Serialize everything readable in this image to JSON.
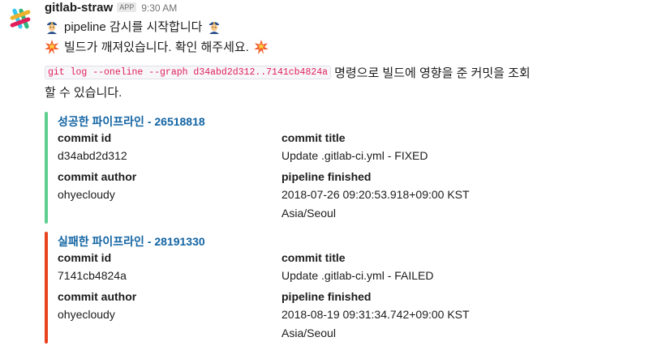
{
  "message": {
    "sender": "gitlab-straw",
    "badge": "APP",
    "time": "9:30 AM",
    "line1": "pipeline 감시를 시작합니다",
    "line2": "빌드가 깨져있습니다. 확인 해주세요.",
    "command": "git log --oneline --graph d34abd2d312..7141cb4824a",
    "line3_rest": "명령으로 빌드에 영향을 준 커밋을 조회",
    "line4": "할 수 있습니다."
  },
  "icons": {
    "avatar": "slack-hash-logo",
    "line1_left": "police-officer-emoji",
    "line1_right": "police-officer-emoji",
    "line2_left": "collision-emoji",
    "line2_right": "collision-emoji"
  },
  "colors": {
    "success": "#5fcf8f",
    "failure": "#e8431e",
    "link": "#1264a3"
  },
  "attachments": [
    {
      "title": "성공한 파이프라인 - 26518818",
      "status": "success",
      "fields": {
        "commit_id_title": "commit id",
        "commit_id_value": "d34abd2d312",
        "commit_title_title": "commit title",
        "commit_title_value": "Update .gitlab-ci.yml - FIXED",
        "commit_author_title": "commit author",
        "commit_author_value": "ohyecloudy",
        "pipeline_finished_title": "pipeline finished",
        "pipeline_finished_value_1": "2018-07-26 09:20:53.918+09:00 KST",
        "pipeline_finished_value_2": "Asia/Seoul"
      }
    },
    {
      "title": "실패한 파이프라인 - 28191330",
      "status": "failure",
      "fields": {
        "commit_id_title": "commit id",
        "commit_id_value": "7141cb4824a",
        "commit_title_title": "commit title",
        "commit_title_value": "Update .gitlab-ci.yml - FAILED",
        "commit_author_title": "commit author",
        "commit_author_value": "ohyecloudy",
        "pipeline_finished_title": "pipeline finished",
        "pipeline_finished_value_1": "2018-08-19 09:31:34.742+09:00 KST",
        "pipeline_finished_value_2": "Asia/Seoul"
      }
    }
  ]
}
